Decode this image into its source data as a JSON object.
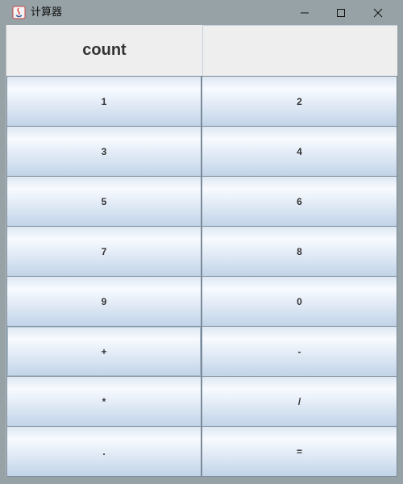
{
  "window": {
    "title": "计算器",
    "app_icon": "java-icon",
    "controls": [
      "minimize-icon",
      "maximize-icon",
      "close-icon"
    ]
  },
  "display": {
    "label": "count",
    "value": ""
  },
  "buttons": [
    "1",
    "2",
    "3",
    "4",
    "5",
    "6",
    "7",
    "8",
    "9",
    "0",
    "+",
    "-",
    "*",
    "/",
    ".",
    "="
  ],
  "colors": {
    "titlebar": "#96a2a6",
    "button_border": "#7a8a99",
    "button_top": "#f8fbff",
    "button_bottom": "#c2d4e8",
    "text": "#333333"
  }
}
